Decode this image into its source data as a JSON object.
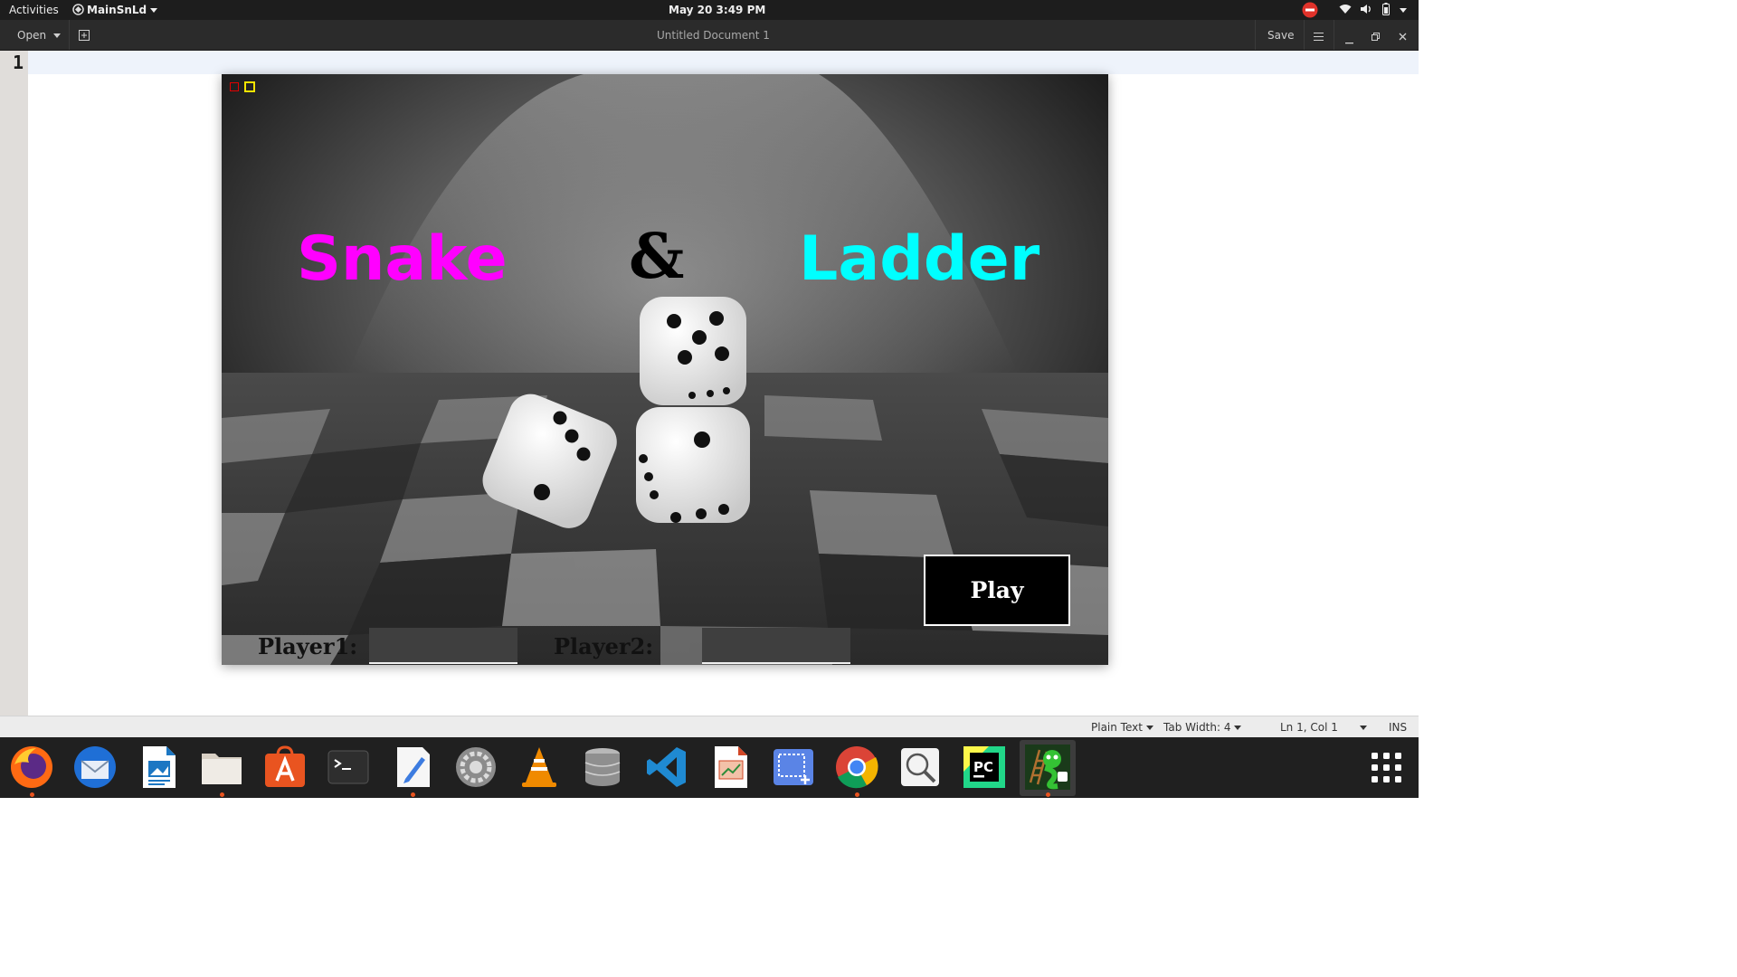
{
  "topbar": {
    "activities": "Activities",
    "app_menu": "MainSnLd",
    "clock": "May 20  3:49 PM"
  },
  "gedit": {
    "open_label": "Open",
    "document_title": "Untitled Document 1",
    "save_label": "Save",
    "line_number": "1"
  },
  "game": {
    "title_snake": "Snake",
    "title_amp": "&",
    "title_ladder": "Ladder",
    "player1_label": "Player1:",
    "player2_label": "Player2:",
    "player1_value": "",
    "player2_value": "",
    "play_label": "Play",
    "colors": {
      "snake": "#ff00ff",
      "ladder": "#00ffff",
      "amp": "#000000"
    }
  },
  "statusbar": {
    "language": "Plain Text",
    "tab_width": "Tab Width: 4",
    "position": "Ln 1, Col 1",
    "mode": "INS"
  },
  "dock": {
    "apps": [
      "firefox-icon",
      "thunderbird-icon",
      "writer-icon",
      "files-icon",
      "software-center-icon",
      "terminal-icon",
      "text-editor-icon",
      "settings-icon",
      "vlc-icon",
      "database-icon",
      "vscode-icon",
      "impress-icon",
      "screenshot-icon",
      "chrome-icon",
      "image-viewer-icon",
      "pycharm-icon",
      "snake-ladder-icon"
    ],
    "show_apps": "show-applications-icon"
  }
}
